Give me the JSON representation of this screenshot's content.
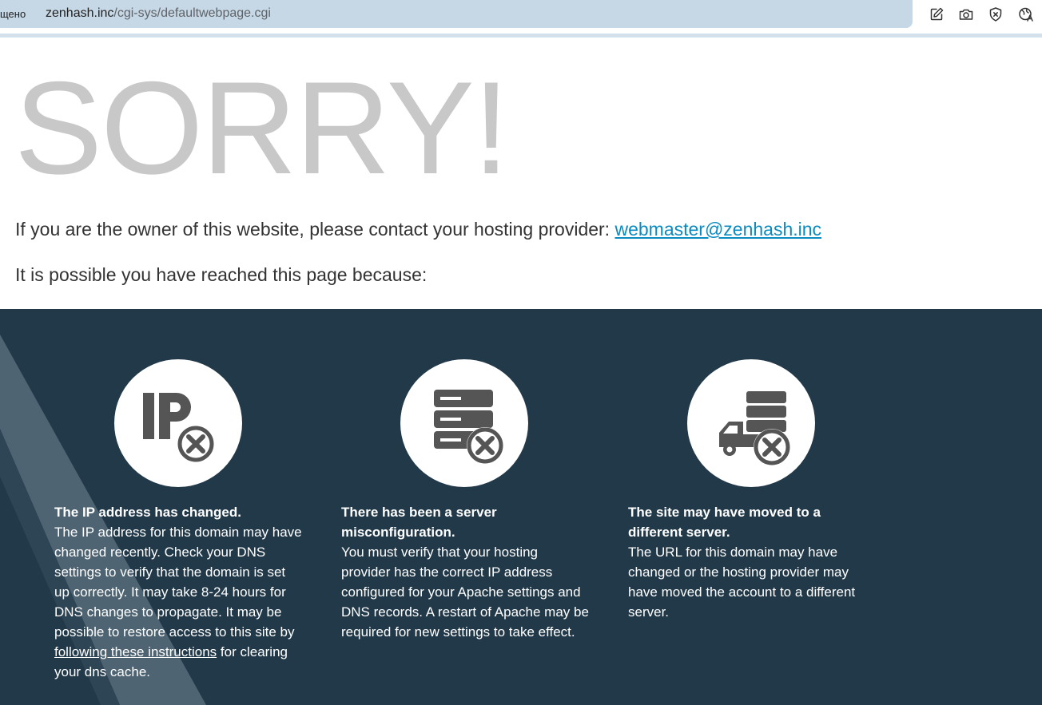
{
  "browser": {
    "status_text": "щено",
    "url_host": "zenhash.inc",
    "url_path": "/cgi-sys/defaultwebpage.cgi",
    "toolbar_icons": [
      "edit-icon",
      "camera-icon",
      "shield-block-icon",
      "translate-globe-icon"
    ]
  },
  "page": {
    "heading": "SORRY!",
    "intro_text": "If you are the owner of this website, please contact your hosting provider: ",
    "contact_email": "webmaster@zenhash.inc",
    "because_text": "It is possible you have reached this page because:"
  },
  "reasons": [
    {
      "icon": "ip-error-icon",
      "title": "The IP address has changed.",
      "body_before": "The IP address for this domain may have changed recently. Check your DNS settings to verify that the domain is set up correctly. It may take 8-24 hours for DNS changes to propagate. It may be possible to restore access to this site by ",
      "link_text": "following these instructions",
      "body_after": " for clearing your dns cache."
    },
    {
      "icon": "server-error-icon",
      "title": "There has been a server misconfiguration.",
      "body": "You must verify that your hosting provider has the correct IP address configured for your Apache settings and DNS records. A restart of Apache may be required for new settings to take effect."
    },
    {
      "icon": "moved-server-icon",
      "title": "The site may have moved to a different server.",
      "body": "The URL for this domain may have changed or the hosting provider may have moved the account to a different server."
    }
  ],
  "colors": {
    "heading": "#c8c8c8",
    "link": "#0a8bc1",
    "dark_section": "#22394a",
    "icon_fill": "#555555"
  }
}
